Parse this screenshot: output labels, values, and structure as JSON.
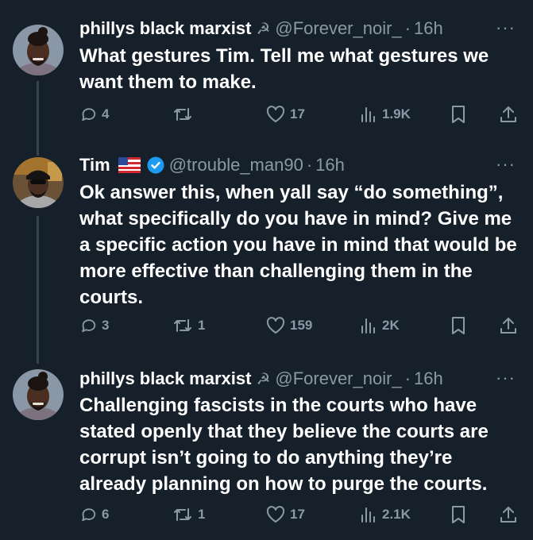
{
  "tweets": [
    {
      "name": "phillys black marxist",
      "badge": "☭",
      "handle": "@Forever_noir_",
      "separator": "·",
      "time": "16h",
      "text": "What gestures Tim. Tell me what gestures we want them to make.",
      "replies": "4",
      "retweets": "",
      "likes": "17",
      "views": "1.9K"
    },
    {
      "name": "Tim",
      "handle": "@trouble_man90",
      "separator": "·",
      "time": "16h",
      "text": "Ok answer this, when yall say “do something”,  what specifically do you have in mind? Give me a specific action you have in mind that would be more effective than challenging them in the courts.",
      "replies": "3",
      "retweets": "1",
      "likes": "159",
      "views": "2K"
    },
    {
      "name": "phillys black marxist",
      "badge": "☭",
      "handle": "@Forever_noir_",
      "separator": "·",
      "time": "16h",
      "text": "Challenging fascists in the courts who have stated openly that they believe the courts are corrupt isn’t going to do anything they’re already planning on how to purge the courts.",
      "replies": "6",
      "retweets": "1",
      "likes": "17",
      "views": "2.1K"
    }
  ],
  "more_label": "···",
  "icons": {
    "reply": "reply-bubble-icon",
    "retweet": "retweet-icon",
    "like": "heart-icon",
    "views": "views-bar-chart-icon",
    "bookmark": "bookmark-icon",
    "share": "share-upload-icon",
    "verified": "verified-badge-icon",
    "flag": "us-flag-icon"
  },
  "colors": {
    "background": "#15202b",
    "text": "#ffffff",
    "muted": "#8b98a5",
    "verified": "#1d9bf0",
    "thread_line": "#38444d"
  }
}
